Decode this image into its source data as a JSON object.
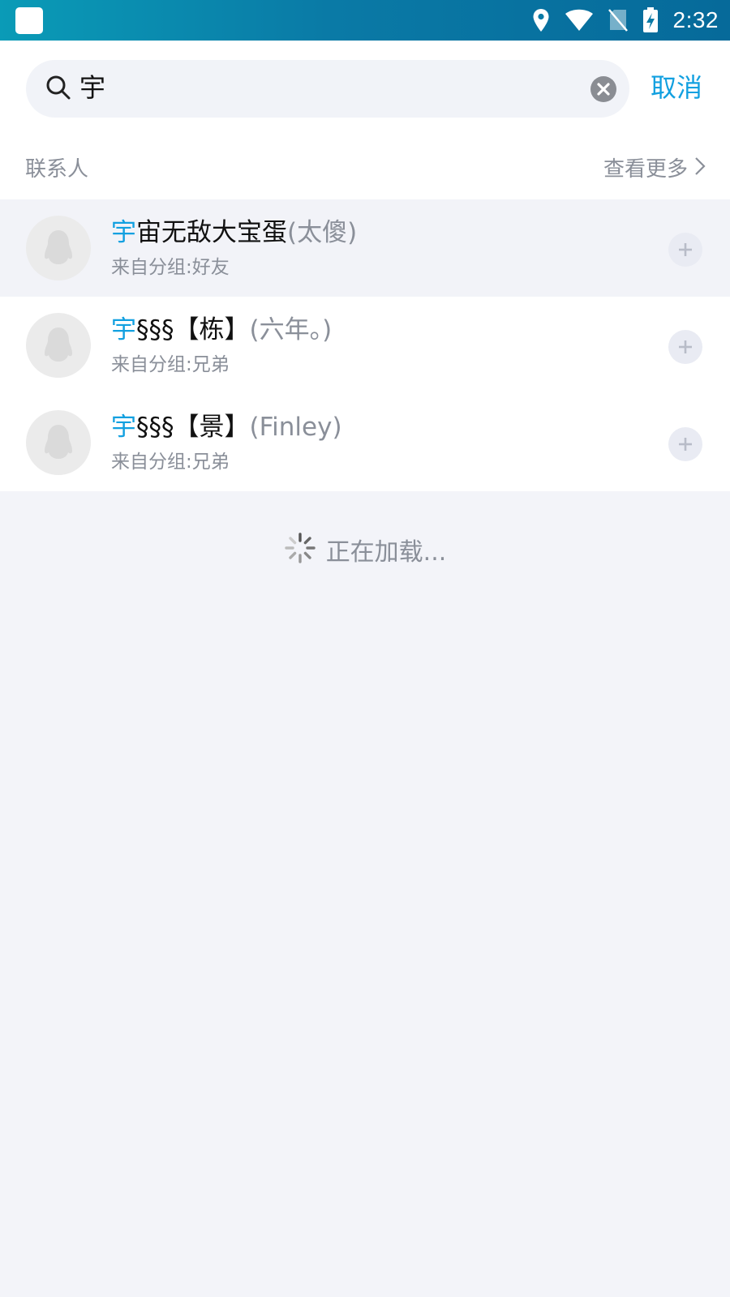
{
  "status_bar": {
    "time": "2:32",
    "icons": [
      "app-square-icon",
      "location-icon",
      "wifi-icon",
      "no-sim-icon",
      "battery-charging-icon"
    ]
  },
  "search": {
    "value": "宇",
    "cancel_label": "取消"
  },
  "section": {
    "title": "联系人",
    "more_label": "查看更多"
  },
  "contacts": [
    {
      "match": "宇",
      "name_rest": "宙无敌大宝蛋",
      "remark": "(太傻)",
      "group": "来自分组:好友",
      "highlighted": true
    },
    {
      "match": "宇",
      "name_rest": "§§§【栋】",
      "remark": "(六年。)",
      "group": "来自分组:兄弟",
      "highlighted": false
    },
    {
      "match": "宇",
      "name_rest": "§§§【景】",
      "remark": "(Finley)",
      "group": "来自分组:兄弟",
      "highlighted": false
    }
  ],
  "loading_text": "正在加载...",
  "colors": {
    "accent": "#12a0e0",
    "muted_text": "#8a8f99",
    "page_bg": "#f3f4f9"
  }
}
